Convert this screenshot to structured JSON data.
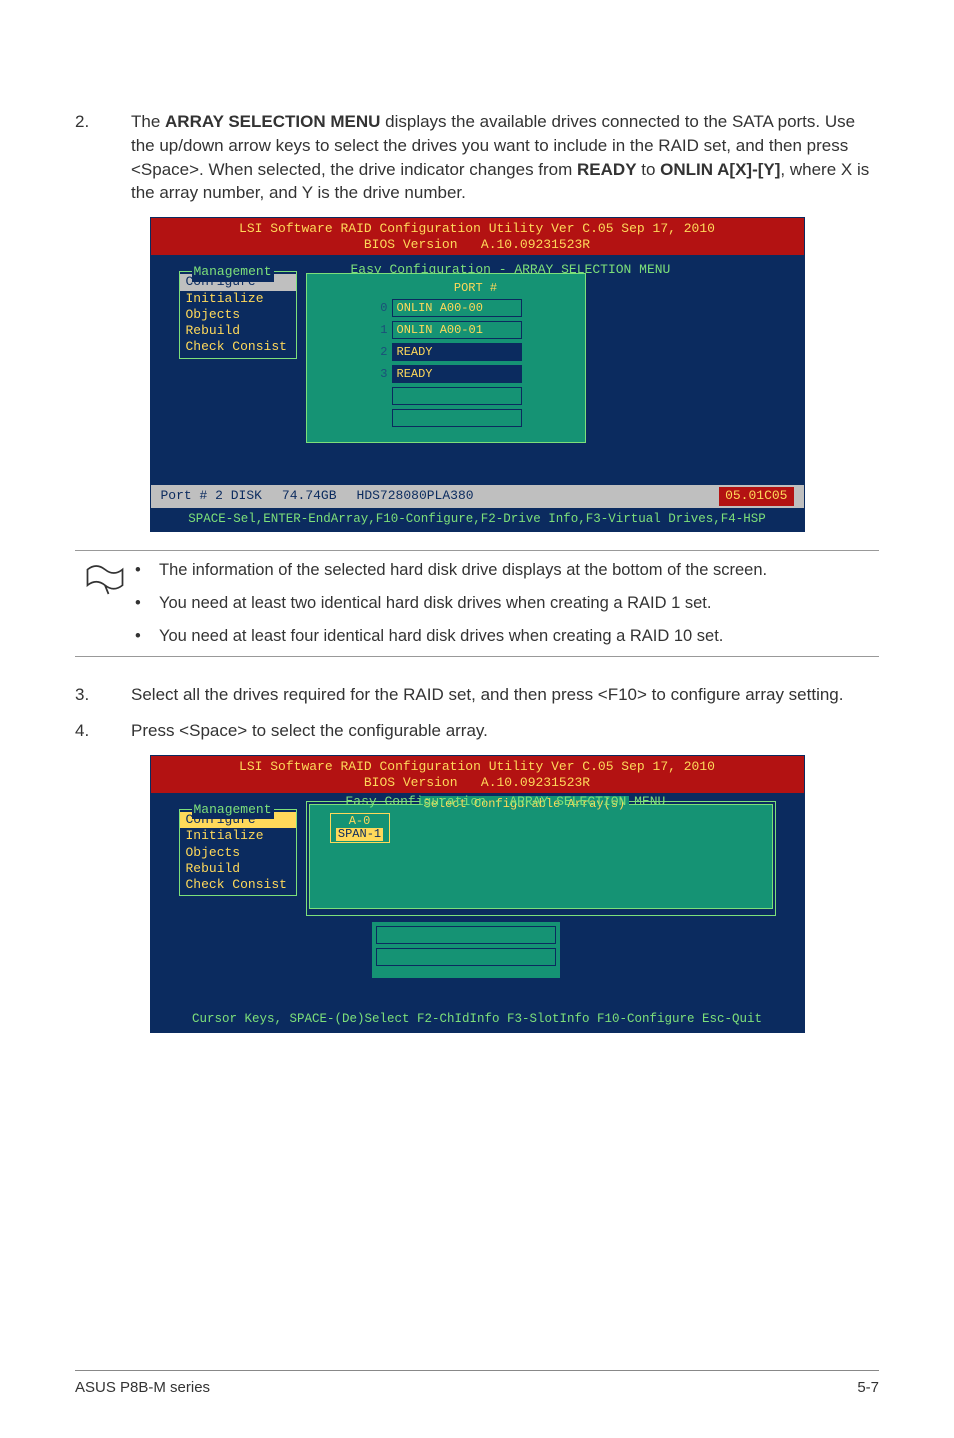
{
  "step2": {
    "num": "2.",
    "text_pre": "The ",
    "bold1": "ARRAY SELECTION MENU",
    "text_mid1": " displays the available drives connected to the SATA ports. Use the up/down arrow keys to select the drives you want to include in the RAID set, and then press <Space>. When selected, the drive indicator changes from ",
    "bold2": "READY",
    "text_mid2": " to ",
    "bold3": "ONLIN A[X]-[Y]",
    "text_end": ", where X is the array number, and Y is the drive number."
  },
  "bios1": {
    "title_line1": "LSI Software RAID Configuration Utility Ver C.05 Sep 17, 2010",
    "title_line2": "BIOS Version   A.10.09231523R",
    "easy_label": "Easy Configuration - ARRAY SELECTION MENU",
    "mgmt_title": "Management",
    "mgmt_items": [
      "Configure",
      "Initialize",
      "Objects",
      "Rebuild",
      "Check Consist"
    ],
    "port_header": "PORT #",
    "drives": [
      {
        "idx": "0",
        "label": "ONLIN A00-00"
      },
      {
        "idx": "1",
        "label": "ONLIN A00-01"
      },
      {
        "idx": "2",
        "label": "READY"
      },
      {
        "idx": "3",
        "label": "READY"
      }
    ],
    "disk_info_port": "Port # 2 DISK",
    "disk_info_size": "74.74GB",
    "disk_info_model": "HDS728080PLA380",
    "disk_info_rev": "05.01C05",
    "footer": "SPACE-Sel,ENTER-EndArray,F10-Configure,F2-Drive Info,F3-Virtual Drives,F4-HSP"
  },
  "notes": {
    "n1": "The information of the selected hard disk drive displays at the bottom of the screen.",
    "n2": "You need at least two identical hard disk drives when creating a RAID 1 set.",
    "n3": "You need at least four identical hard disk drives when creating a RAID 10 set."
  },
  "step3": {
    "num": "3.",
    "text": "Select all the drives required for the RAID set, and then press <F10> to configure array setting."
  },
  "step4": {
    "num": "4.",
    "text": "Press <Space> to select the configurable array."
  },
  "bios2": {
    "title_line1": "LSI Software RAID Configuration Utility Ver C.05 Sep 17, 2010",
    "title_line2": "BIOS Version   A.10.09231523R",
    "easy_label": "Easy Configuration - ARRAY SELECTION MENU",
    "span_title": "Select Configurable Array(s)",
    "a0": "A-0",
    "span1": "SPAN-1",
    "mgmt_title": "Management",
    "mgmt_items": [
      "Configure",
      "Initialize",
      "Objects",
      "Rebuild",
      "Check Consist"
    ],
    "footer": "Cursor Keys, SPACE-(De)Select F2-ChIdInfo F3-SlotInfo F10-Configure Esc-Quit"
  },
  "footer": {
    "left": "ASUS P8B-M series",
    "right": "5-7"
  }
}
